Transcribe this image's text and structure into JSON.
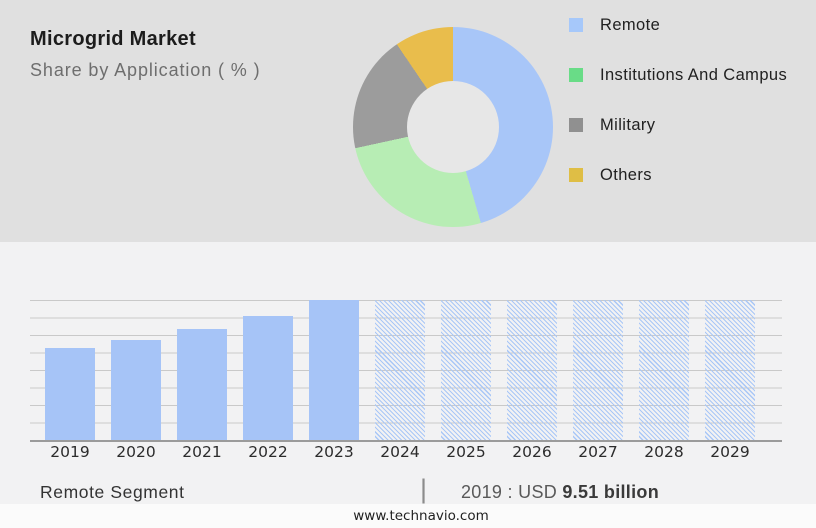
{
  "header": {
    "title": "Microgrid Market",
    "subtitle": "Share by Application ( % )"
  },
  "chart_data": [
    {
      "type": "pie",
      "variant": "donut",
      "title": "Share by Application ( % )",
      "labels": [
        "Remote",
        "Institutions And Campus",
        "Military",
        "Others"
      ],
      "values_pct": [
        45.5,
        26.1,
        18.9,
        9.5
      ],
      "colors": [
        "#a8c6f8",
        "#b7edb4",
        "#9c9c9c",
        "#e9bd4c"
      ],
      "legend_swatch_colors": [
        "#a6c8fa",
        "#69dc87",
        "#909090",
        "#dfbe45"
      ],
      "legend_position": "right",
      "start_angle_deg": 0,
      "direction": "clockwise"
    },
    {
      "type": "bar",
      "title": "Remote Segment",
      "categories": [
        "2019",
        "2020",
        "2021",
        "2022",
        "2023",
        "2024",
        "2025",
        "2026",
        "2027",
        "2028",
        "2029"
      ],
      "values_usd_billion": [
        9.51,
        10.35,
        11.5,
        12.85,
        14.5,
        14.5,
        14.5,
        14.5,
        14.5,
        14.5,
        14.5
      ],
      "bar_styles": [
        "solid",
        "solid",
        "solid",
        "solid",
        "solid",
        "hatched",
        "hatched",
        "hatched",
        "hatched",
        "hatched",
        "hatched"
      ],
      "bar_color": "#a6c4f7",
      "hatch_line_color": "#a9c7f7",
      "grid_on": true,
      "gridline_count": 9,
      "ylim": [
        0,
        14.5
      ],
      "labeled_value": {
        "category": "2019",
        "text": "2019 : USD 9.51 billion"
      }
    }
  ],
  "footer": {
    "segment_label": "Remote Segment",
    "separator": "|",
    "value_prefix": "2019 : USD ",
    "value_bold": "9.51 billion",
    "website": "www.technavio.com"
  },
  "palette": {
    "top_panel_bg": "#e0e0e0",
    "bottom_panel_bg": "#f2f2f3",
    "footer_strip_bg": "#fbfbfb",
    "gridline": "#c9c9c9",
    "axis_line": "#9b9b9b",
    "donut_hole": "#e7e7e7"
  }
}
